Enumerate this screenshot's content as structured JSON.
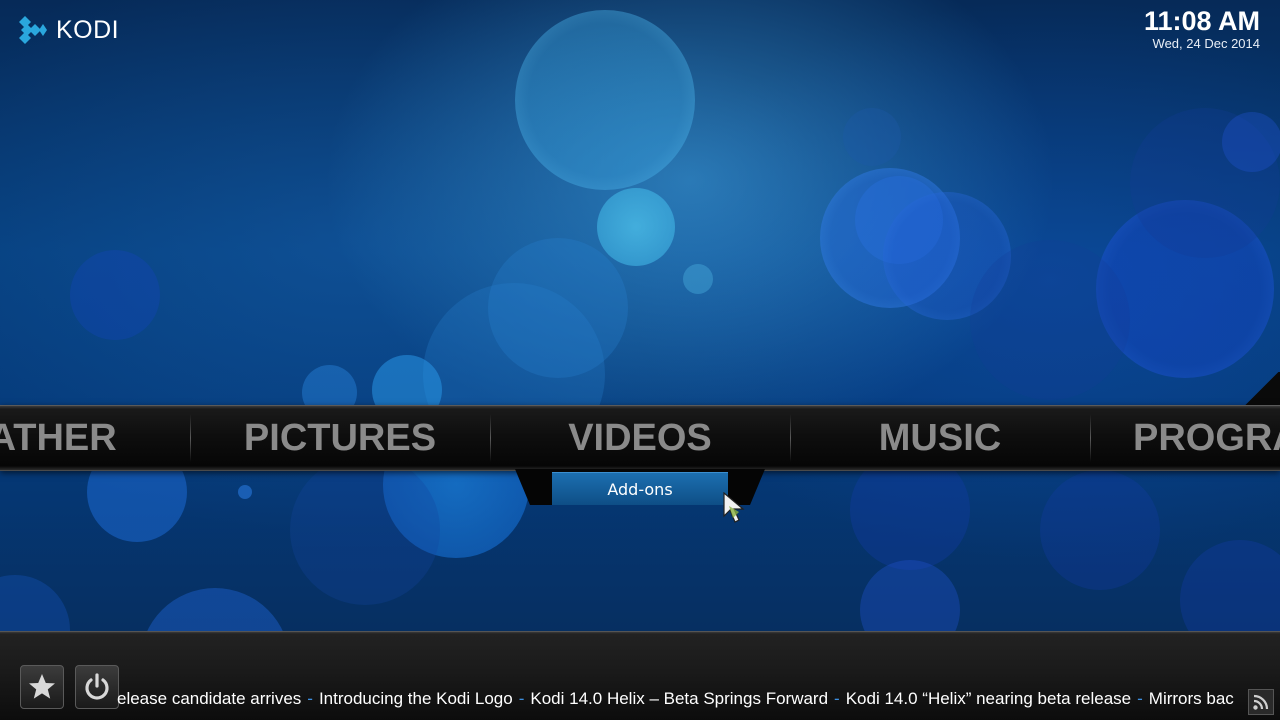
{
  "header": {
    "logo_text": "KODI",
    "time": "11:08 AM",
    "date": "Wed, 24 Dec 2014"
  },
  "main_menu": {
    "items": [
      "EATHER",
      "PICTURES",
      "VIDEOS",
      "MUSIC",
      "PROGRA"
    ],
    "selected": "VIDEOS"
  },
  "submenu": {
    "items": [
      "Add-ons"
    ]
  },
  "bottom_bar": {
    "buttons": [
      {
        "name": "favourites",
        "icon": "star-icon"
      },
      {
        "name": "power",
        "icon": "power-icon"
      }
    ],
    "ticker": [
      "elease candidate arrives",
      "Introducing the Kodi Logo",
      "Kodi 14.0 Helix – Beta Springs Forward",
      "Kodi 14.0 “Helix” nearing beta release",
      "Mirrors bac"
    ],
    "ticker_separator": "-",
    "rss_icon": "rss-icon"
  },
  "colors": {
    "accent_blue": "#1c6fb0",
    "menu_text": "#8a8a8a",
    "ticker_separator": "#3d8fe0"
  }
}
